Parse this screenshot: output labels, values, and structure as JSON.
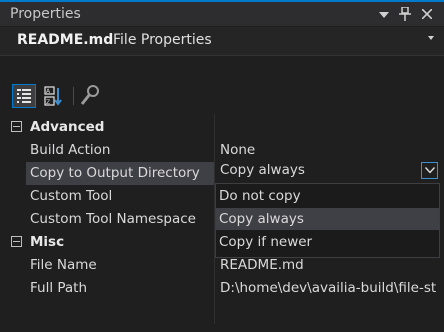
{
  "panel": {
    "title": "Properties",
    "icons": [
      "dropdown-arrow-icon",
      "pin-icon",
      "close-icon"
    ]
  },
  "object": {
    "name": "README.md",
    "type": "File Properties"
  },
  "toolbar": {
    "buttons": [
      "categorized-icon",
      "alphabetical-icon",
      "property-pages-icon"
    ]
  },
  "grid": {
    "advanced": {
      "label": "Advanced",
      "props": [
        {
          "name": "Build Action",
          "value": "None"
        },
        {
          "name": "Copy to Output Directory",
          "value": "Copy always"
        },
        {
          "name": "Custom Tool",
          "value": ""
        },
        {
          "name": "Custom Tool Namespace",
          "value": ""
        }
      ]
    },
    "misc": {
      "label": "Misc",
      "props": [
        {
          "name": "File Name",
          "value": "README.md"
        },
        {
          "name": "Full Path",
          "value": "D:\\home\\dev\\availia-build\\file-st"
        }
      ]
    }
  },
  "dropdown": {
    "options": [
      "Do not copy",
      "Copy always",
      "Copy if newer"
    ],
    "selected": "Copy always"
  },
  "colors": {
    "accent": "#007acc",
    "selection": "#3f3f46"
  }
}
